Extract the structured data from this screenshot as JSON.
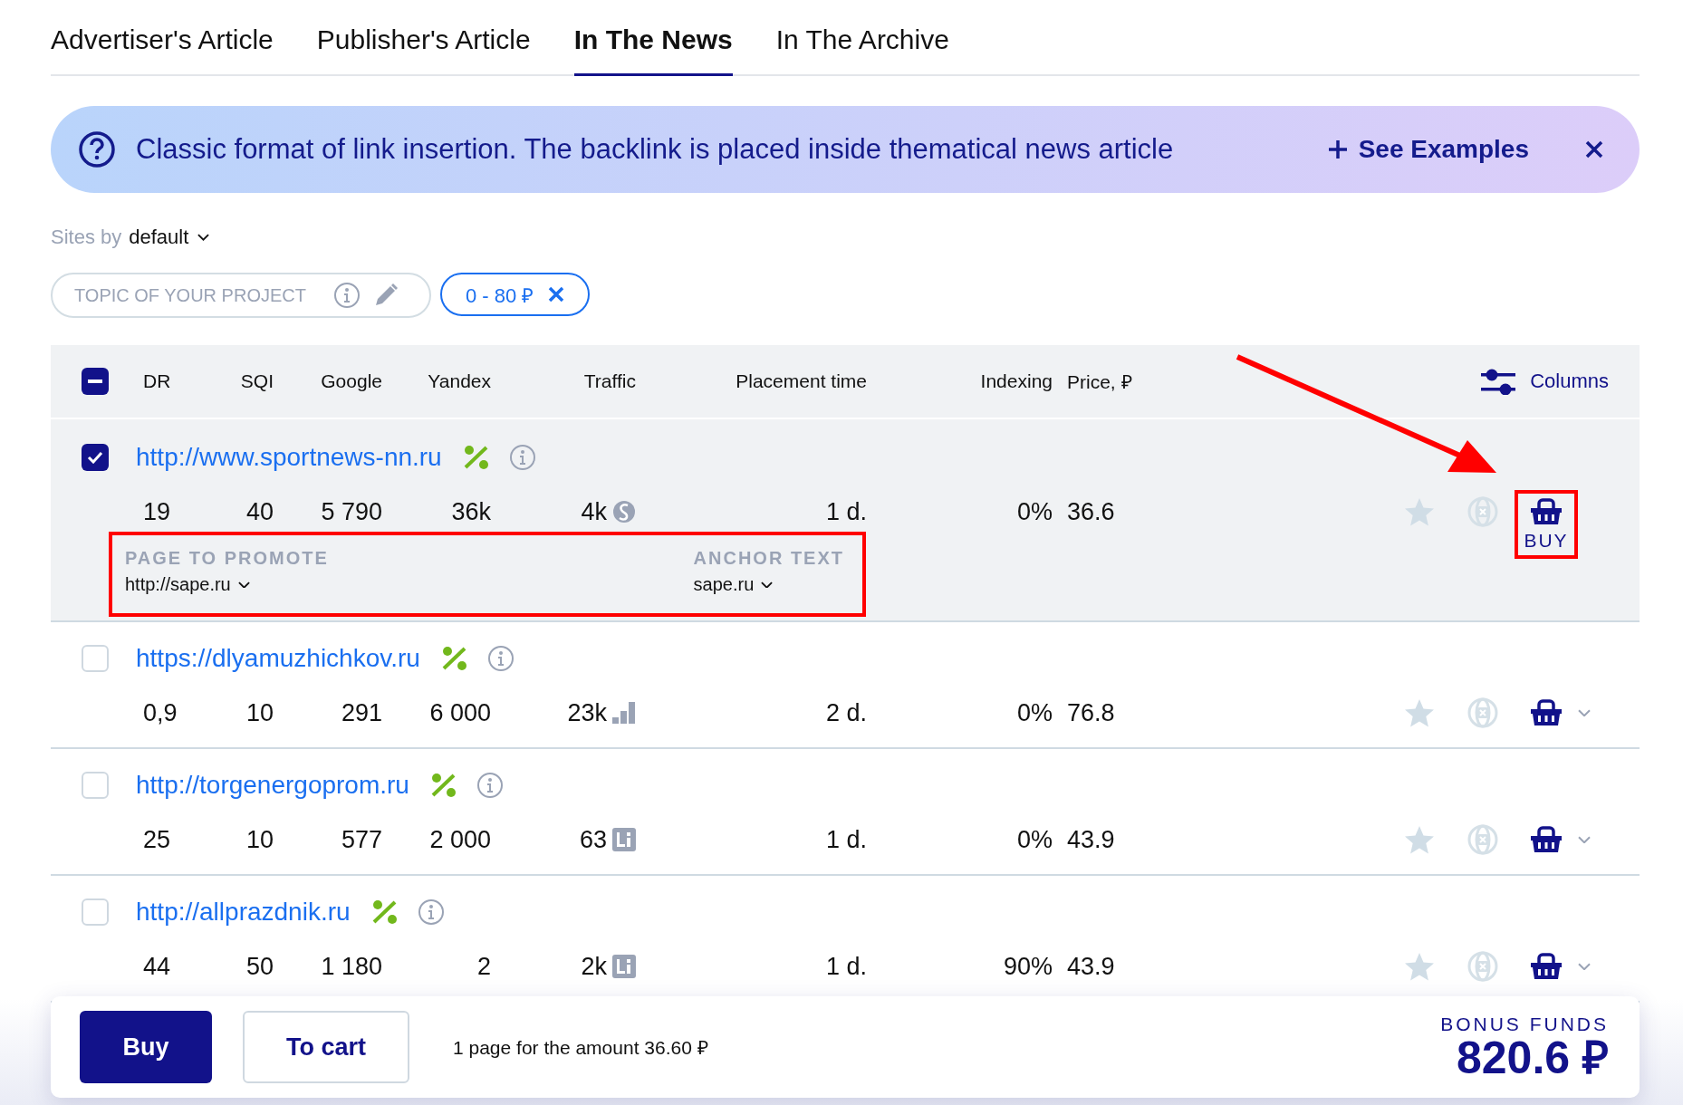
{
  "tabs": [
    {
      "label": "Advertiser's Article",
      "selected": false
    },
    {
      "label": "Publisher's Article",
      "selected": false
    },
    {
      "label": "In The News",
      "selected": true
    },
    {
      "label": "In The Archive",
      "selected": false
    }
  ],
  "banner": {
    "text": "Classic format of link insertion. The backlink is placed inside thematical news article",
    "action": "See Examples"
  },
  "sort": {
    "prefix": "Sites by",
    "value": "default"
  },
  "filters": {
    "topic_placeholder": "TOPIC OF YOUR PROJECT",
    "price_chip": "0 - 80 ₽"
  },
  "table": {
    "select_all_partial": true,
    "columns": [
      "DR",
      "SQI",
      "Google",
      "Yandex",
      "Traffic",
      "Placement time",
      "Indexing",
      "Price, ₽"
    ],
    "columns_button": "Columns",
    "rows": [
      {
        "url": "http://www.sportnews-nn.ru",
        "checked": true,
        "expanded": true,
        "dr": "19",
        "sqi": "40",
        "google": "5 790",
        "yandex": "36k",
        "traffic": {
          "value": "4k",
          "kind": "semrush"
        },
        "placement": "1 d.",
        "indexing": "0%",
        "price": "36.6",
        "promote": {
          "label": "PAGE TO PROMOTE",
          "value": "http://sape.ru"
        },
        "anchor": {
          "label": "ANCHOR TEXT",
          "value": "sape.ru"
        },
        "buy_label": "BUY"
      },
      {
        "url": "https://dlyamuzhichkov.ru",
        "checked": false,
        "expanded": false,
        "dr": "0,9",
        "sqi": "10",
        "google": "291",
        "yandex": "6 000",
        "traffic": {
          "value": "23k",
          "kind": "bars"
        },
        "placement": "2 d.",
        "indexing": "0%",
        "price": "76.8"
      },
      {
        "url": "http://torgenergoprom.ru",
        "checked": false,
        "expanded": false,
        "dr": "25",
        "sqi": "10",
        "google": "577",
        "yandex": "2 000",
        "traffic": {
          "value": "63",
          "kind": "liveinternet"
        },
        "placement": "1 d.",
        "indexing": "0%",
        "price": "43.9"
      },
      {
        "url": "http://allprazdnik.ru",
        "checked": false,
        "expanded": false,
        "dr": "44",
        "sqi": "50",
        "google": "1 180",
        "yandex": "2",
        "traffic": {
          "value": "2k",
          "kind": "liveinternet"
        },
        "placement": "1 d.",
        "indexing": "90%",
        "price": "43.9"
      }
    ]
  },
  "footer": {
    "buy": "Buy",
    "to_cart": "To cart",
    "summary": "1 page for the amount 36.60 ₽",
    "bonus_label": "BONUS FUNDS",
    "bonus_value": "820.6 ₽"
  }
}
